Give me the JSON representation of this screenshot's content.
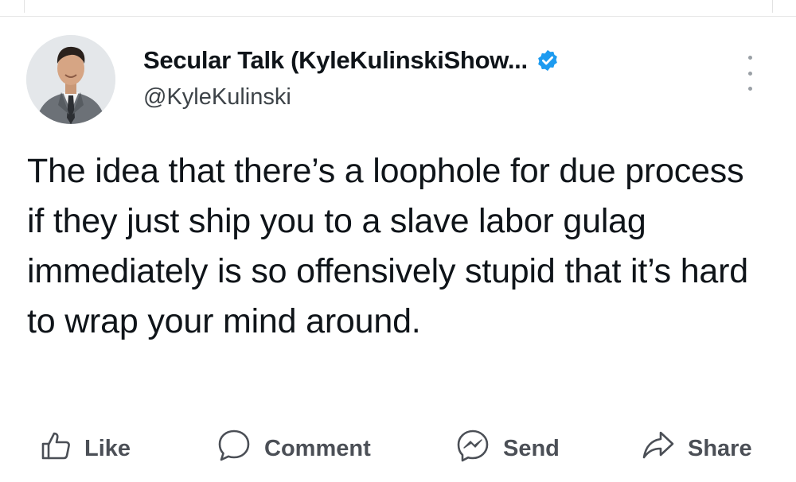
{
  "post": {
    "author": {
      "display_name": "Secular Talk (KyleKulinskiShow...",
      "handle": "@KyleKulinski",
      "verified": true,
      "verified_color": "#1d9bf0"
    },
    "text": "The idea that there’s a loophole for due process if they just ship you to a slave labor gulag immediately is so offensively stupid that it’s hard to wrap your mind around."
  },
  "actions": {
    "like_label": "Like",
    "comment_label": "Comment",
    "send_label": "Send",
    "share_label": "Share"
  },
  "icons": {
    "like": "thumbs-up-icon",
    "comment": "speech-bubble-icon",
    "send": "messenger-icon",
    "share": "share-arrow-icon",
    "more": "more-vertical-icon",
    "verified": "verified-badge-icon"
  }
}
